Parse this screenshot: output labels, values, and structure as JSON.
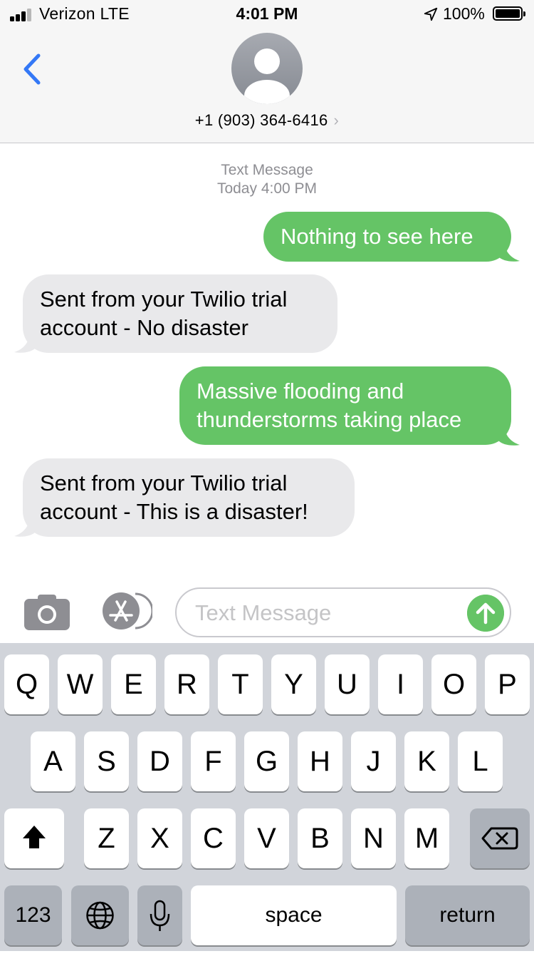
{
  "status_bar": {
    "carrier": "Verizon  LTE",
    "time": "4:01 PM",
    "battery": "100%",
    "icons": [
      "signal-icon",
      "location-icon",
      "battery-icon"
    ]
  },
  "header": {
    "contact": "+1 (903) 364-6416",
    "chevron": "›",
    "icons": [
      "back-chevron-icon",
      "person-avatar-icon"
    ]
  },
  "conversation": {
    "meta_type": "Text Message",
    "meta_time": "Today 4:00 PM",
    "messages": [
      {
        "direction": "sent",
        "lines": [
          "Nothing to see here"
        ]
      },
      {
        "direction": "received",
        "lines": [
          "Sent from your Twilio trial",
          "account - No disaster"
        ]
      },
      {
        "direction": "sent",
        "lines": [
          "Massive flooding and",
          "thunderstorms taking place"
        ]
      },
      {
        "direction": "received",
        "lines": [
          "Sent from your Twilio trial",
          "account - This is a disaster!"
        ]
      }
    ]
  },
  "input_bar": {
    "placeholder": "Text Message",
    "icons": [
      "camera-icon",
      "app-store-icon",
      "send-arrow-icon"
    ]
  },
  "keyboard": {
    "row1": [
      "Q",
      "W",
      "E",
      "R",
      "T",
      "Y",
      "U",
      "I",
      "O",
      "P"
    ],
    "row2": [
      "A",
      "S",
      "D",
      "F",
      "G",
      "H",
      "J",
      "K",
      "L"
    ],
    "row3": [
      "Z",
      "X",
      "C",
      "V",
      "B",
      "N",
      "M"
    ],
    "numbers": "123",
    "space": "space",
    "return": "return",
    "icons": [
      "shift-icon",
      "delete-icon",
      "globe-icon",
      "microphone-icon"
    ]
  },
  "colors": {
    "sent_bubble": "#65c466",
    "received_bubble": "#e9e9eb",
    "accent_blue": "#3478f6",
    "keyboard_bg": "#d1d4da"
  }
}
